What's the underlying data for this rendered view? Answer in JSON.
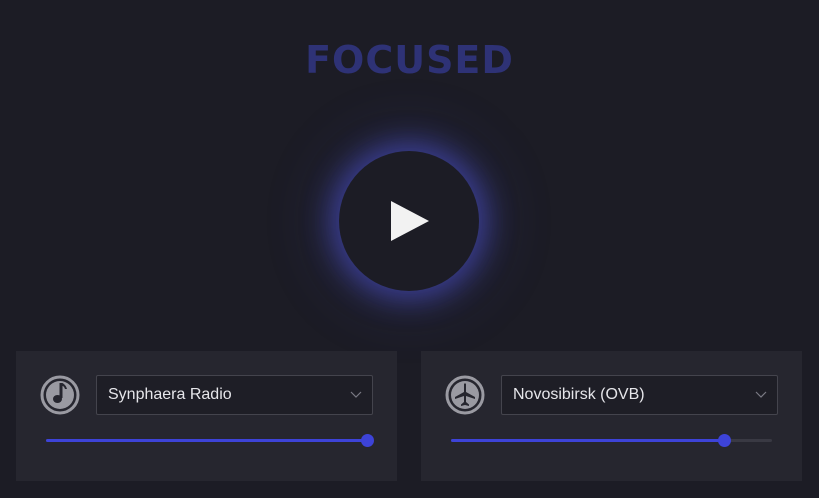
{
  "app": {
    "title": "FOCUSED",
    "play_icon": "play-icon"
  },
  "music_panel": {
    "icon": "music-note-icon",
    "station": "Synphaera Radio",
    "volume": 1.0
  },
  "ambience_panel": {
    "icon": "airplane-icon",
    "location": "Novosibirsk (OVB)",
    "volume": 0.85
  },
  "colors": {
    "accent": "#3d43d8",
    "title": "#2e3276",
    "background": "#1c1c25",
    "panel": "#26262f"
  }
}
